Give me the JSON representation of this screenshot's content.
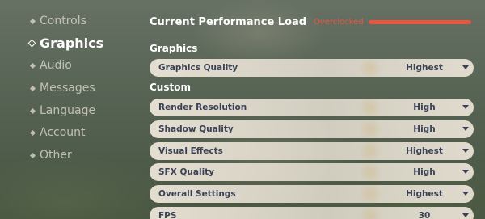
{
  "sidebar": {
    "items": [
      {
        "label": "Controls"
      },
      {
        "label": "Graphics"
      },
      {
        "label": "Audio"
      },
      {
        "label": "Messages"
      },
      {
        "label": "Language"
      },
      {
        "label": "Account"
      },
      {
        "label": "Other"
      }
    ]
  },
  "header": {
    "title": "Current Performance Load",
    "status": "Overclocked",
    "status_color": "#e8563f"
  },
  "sections": {
    "graphics_title": "Graphics",
    "custom_title": "Custom"
  },
  "settings": {
    "graphics_quality": {
      "label": "Graphics Quality",
      "value": "Highest"
    },
    "render_resolution": {
      "label": "Render Resolution",
      "value": "High"
    },
    "shadow_quality": {
      "label": "Shadow Quality",
      "value": "High"
    },
    "visual_effects": {
      "label": "Visual Effects",
      "value": "Highest"
    },
    "sfx_quality": {
      "label": "SFX Quality",
      "value": "High"
    },
    "overall_settings": {
      "label": "Overall Settings",
      "value": "Highest"
    },
    "fps": {
      "label": "FPS",
      "value": "30"
    }
  },
  "icons": {
    "nav_marker": "diamond-icon",
    "dropdown": "caret-down-icon"
  }
}
